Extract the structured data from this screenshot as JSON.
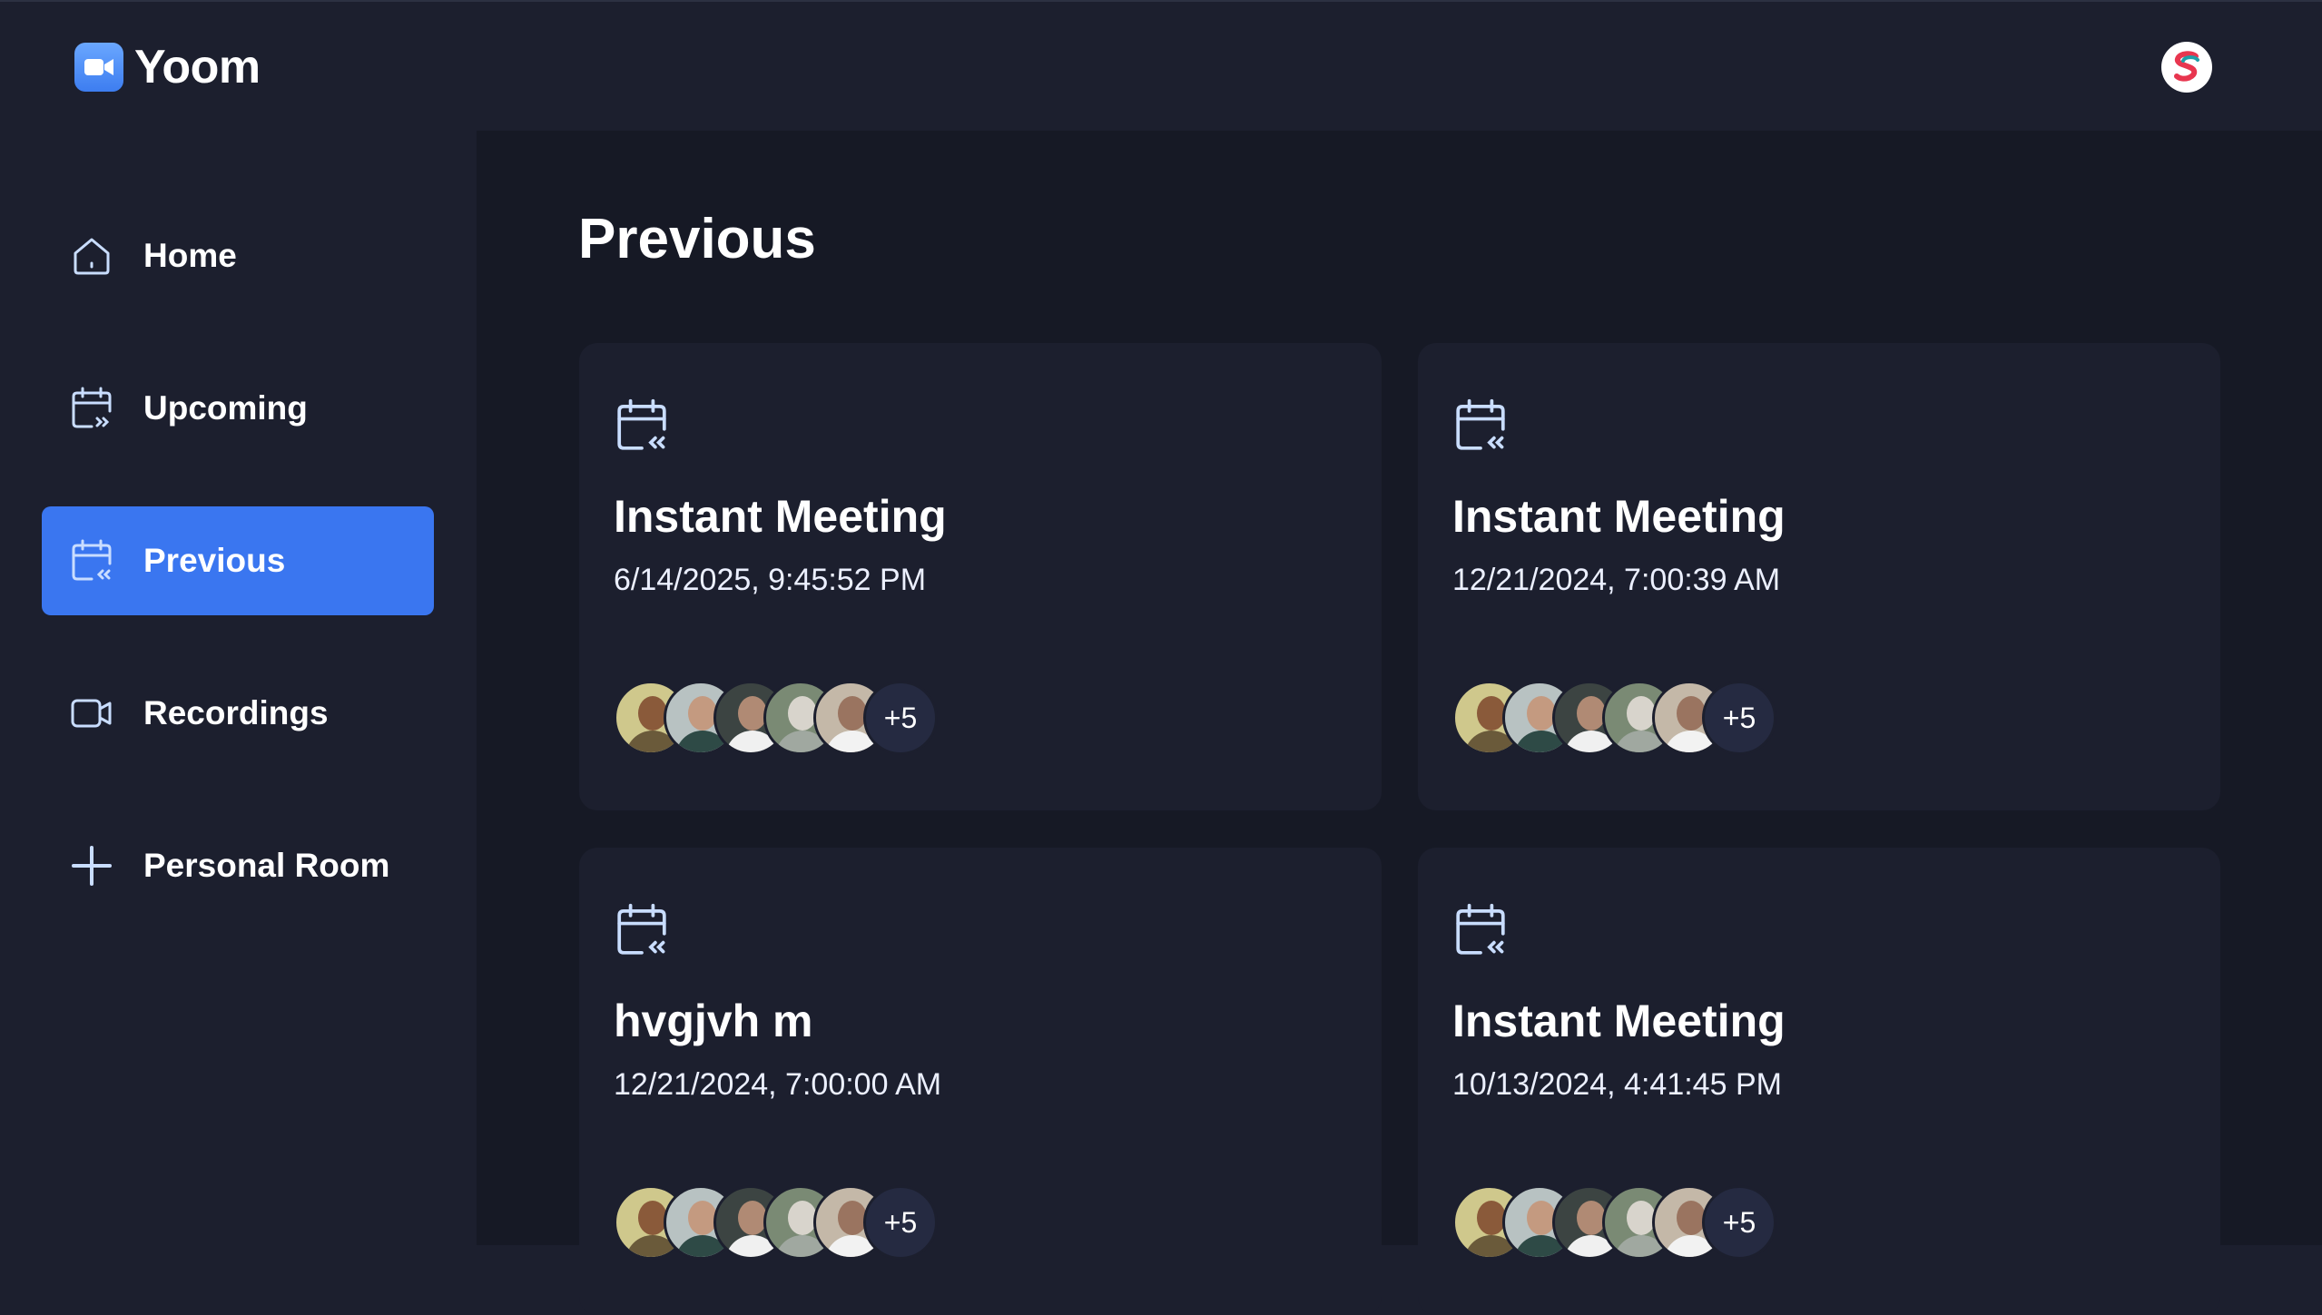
{
  "app": {
    "name": "Yoom"
  },
  "colors": {
    "accent": "#3a76f0",
    "bg": "#1c1f2e",
    "main_bg": "#161925",
    "icon_tint": "#c9ddff"
  },
  "sidebar": {
    "items": [
      {
        "label": "Home",
        "icon": "home-icon",
        "active": false
      },
      {
        "label": "Upcoming",
        "icon": "calendar-upcoming-icon",
        "active": false
      },
      {
        "label": "Previous",
        "icon": "calendar-previous-icon",
        "active": true
      },
      {
        "label": "Recordings",
        "icon": "video-icon",
        "active": false
      },
      {
        "label": "Personal Room",
        "icon": "plus-icon",
        "active": false
      }
    ]
  },
  "main": {
    "title": "Previous",
    "cards": [
      {
        "icon": "calendar-previous-icon",
        "title": "Instant Meeting",
        "date": "6/14/2025, 9:45:52 PM",
        "more_count": "+5"
      },
      {
        "icon": "calendar-previous-icon",
        "title": "Instant Meeting",
        "date": "12/21/2024, 7:00:39 AM",
        "more_count": "+5"
      },
      {
        "icon": "calendar-previous-icon",
        "title": "hvgjvh m",
        "date": "12/21/2024, 7:00:00 AM",
        "more_count": "+5"
      },
      {
        "icon": "calendar-previous-icon",
        "title": "Instant Meeting",
        "date": "10/13/2024, 4:41:45 PM",
        "more_count": "+5"
      }
    ]
  }
}
